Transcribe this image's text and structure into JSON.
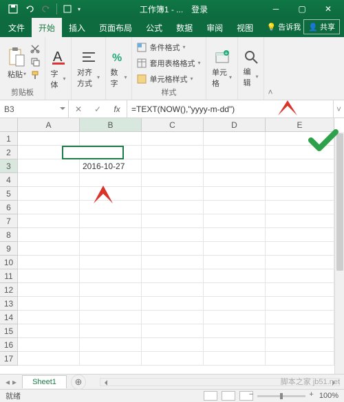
{
  "title_bar": {
    "doc": "工作簿1 - ...",
    "login": "登录"
  },
  "tabs": {
    "file": "文件",
    "home": "开始",
    "insert": "插入",
    "layout": "页面布局",
    "formulas": "公式",
    "data": "数据",
    "review": "审阅",
    "view": "视图",
    "tell_me": "告诉我",
    "share": "共享"
  },
  "ribbon": {
    "clipboard": {
      "paste": "粘贴",
      "label": "剪贴板"
    },
    "font": {
      "btn": "字体"
    },
    "align": {
      "btn": "对齐方式"
    },
    "number": {
      "btn": "数字"
    },
    "styles": {
      "cond": "条件格式",
      "table": "套用表格格式",
      "cell": "单元格样式",
      "label": "样式"
    },
    "cells": {
      "btn": "单元格"
    },
    "editing": {
      "btn": "编辑"
    }
  },
  "namebox": "B3",
  "formula": "=TEXT(NOW(),\"yyyy-m-dd\")",
  "columns": [
    "A",
    "B",
    "C",
    "D",
    "E"
  ],
  "rows": [
    "1",
    "2",
    "3",
    "4",
    "5",
    "6",
    "7",
    "8",
    "9",
    "10",
    "11",
    "12",
    "13",
    "14",
    "15",
    "16",
    "17"
  ],
  "cells": {
    "B3": "2016-10-27"
  },
  "sheet": {
    "name": "Sheet1"
  },
  "status": {
    "ready": "就绪",
    "zoom": "100%"
  },
  "watermark": "脚本之家  jb51.net"
}
